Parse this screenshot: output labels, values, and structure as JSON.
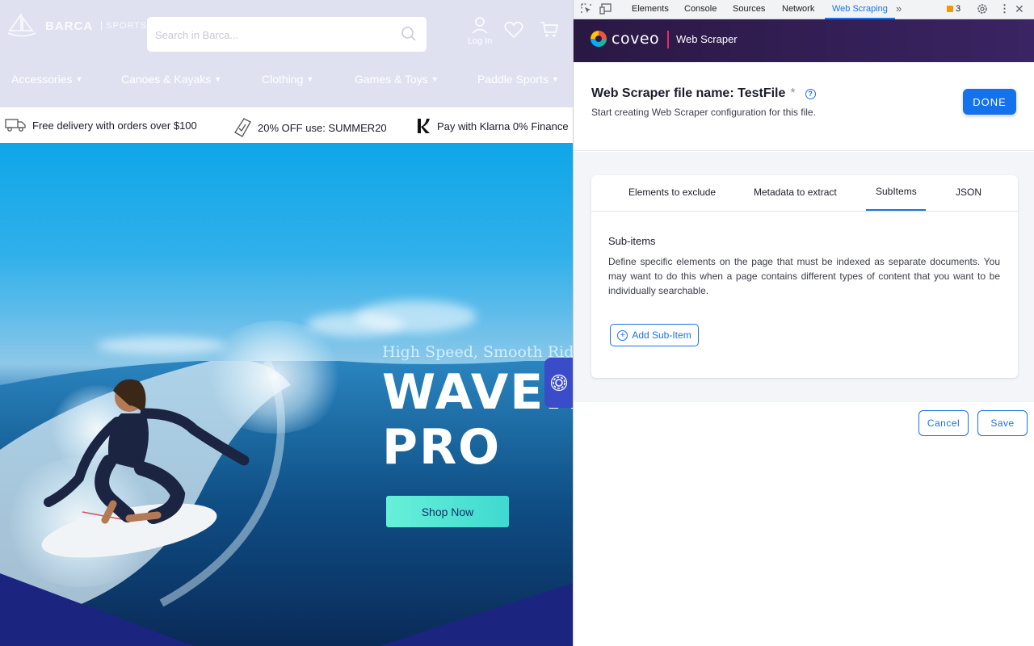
{
  "site": {
    "logo": {
      "brand": "BARCA",
      "sub": "SPORTS"
    },
    "search": {
      "placeholder": "Search in Barca..."
    },
    "login_label": "Log In",
    "nav": [
      {
        "label": "Accessories"
      },
      {
        "label": "Canoes & Kayaks"
      },
      {
        "label": "Clothing"
      },
      {
        "label": "Games & Toys"
      },
      {
        "label": "Paddle Sports"
      }
    ],
    "promos": [
      {
        "text": "Free delivery with orders over $100",
        "icon": "truck-icon"
      },
      {
        "text": "20% OFF use: SUMMER20",
        "icon": "tag-icon"
      },
      {
        "text": "Pay with Klarna 0% Finance",
        "icon": "klarna-icon"
      }
    ],
    "hero": {
      "tagline": "High Speed, Smooth Ride",
      "title": "WAVER\nPRO",
      "cta": "Shop Now"
    }
  },
  "devtools": {
    "tabs": [
      {
        "label": "Elements"
      },
      {
        "label": "Console"
      },
      {
        "label": "Sources"
      },
      {
        "label": "Network"
      },
      {
        "label": "Web Scraping",
        "active": true
      }
    ],
    "issues_count": "3",
    "accent_color": "#1a73e8"
  },
  "scraper": {
    "logo_word": "coveo",
    "product_name": "Web Scraper",
    "file_title": "Web Scraper file name: TestFile",
    "required_mark": "*",
    "help_icon": "?",
    "file_subtitle": "Start creating Web Scraper configuration for this file.",
    "done_label": "DONE",
    "tabs": [
      {
        "label": "Elements to exclude"
      },
      {
        "label": "Metadata to extract"
      },
      {
        "label": "SubItems",
        "active": true
      },
      {
        "label": "JSON"
      }
    ],
    "section_title": "Sub-items",
    "section_desc": "Define specific elements on the page that must be indexed as separate documents. You may want to do this when a page contains different types of content that you want to be individually searchable.",
    "add_label": "Add Sub-Item",
    "cancel_label": "Cancel",
    "save_label": "Save",
    "header_gradient": [
      "#2a1843",
      "#3a2463"
    ]
  }
}
